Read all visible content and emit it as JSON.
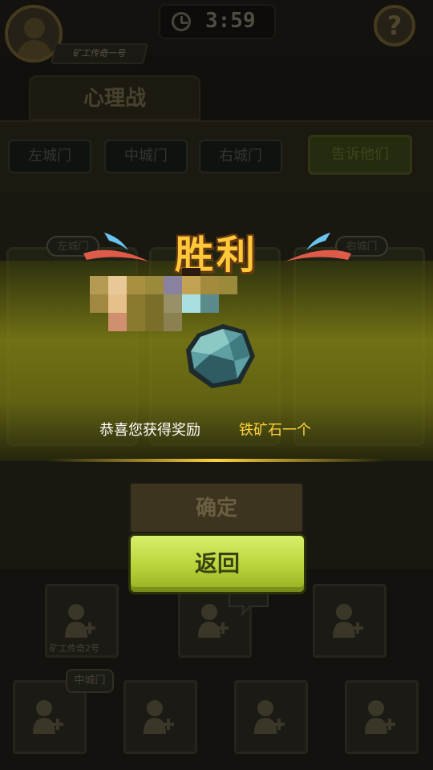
{
  "header": {
    "player_name": "矿工传奇一号",
    "timer": "3:59",
    "help_label": "?"
  },
  "tab": {
    "title": "心理战"
  },
  "gates": {
    "left": "左城门",
    "middle": "中城门",
    "right": "右城门",
    "tell_button": "告诉他们"
  },
  "cards": {
    "left_label": "左城门",
    "right_label": "右城门"
  },
  "victory": {
    "title": "胜利",
    "reward_text": "恭喜您获得奖励",
    "reward_item": "铁矿石一个"
  },
  "buttons": {
    "confirm": "确定",
    "back": "返回"
  },
  "slots": {
    "slot2_name": "矿工传奇2号",
    "bubble_middle_gate": "中城门"
  },
  "colors": {
    "accent_green": "#b8d43a",
    "victory_gold": "#ffc93a",
    "reward_item": "#ffd23a"
  }
}
